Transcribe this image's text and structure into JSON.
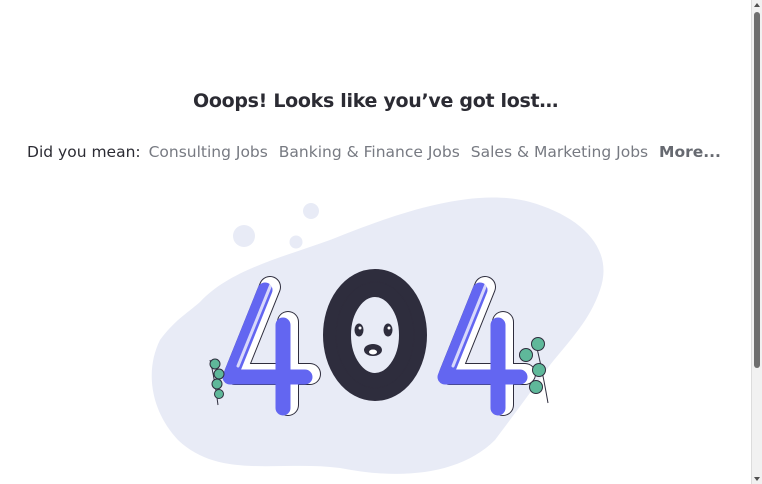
{
  "error": {
    "title": "Ooops! Looks like you’ve got lost…",
    "suggest_prefix": "Did you mean:",
    "links": [
      "Consulting Jobs",
      "Banking & Finance Jobs",
      "Sales & Marketing Jobs"
    ],
    "more_label": "More...",
    "illustration_text": "404",
    "colors": {
      "accent": "#6366f1",
      "dark": "#2e2d3d",
      "blob": "#e8ebf6",
      "leaf": "#5fb89a"
    }
  }
}
